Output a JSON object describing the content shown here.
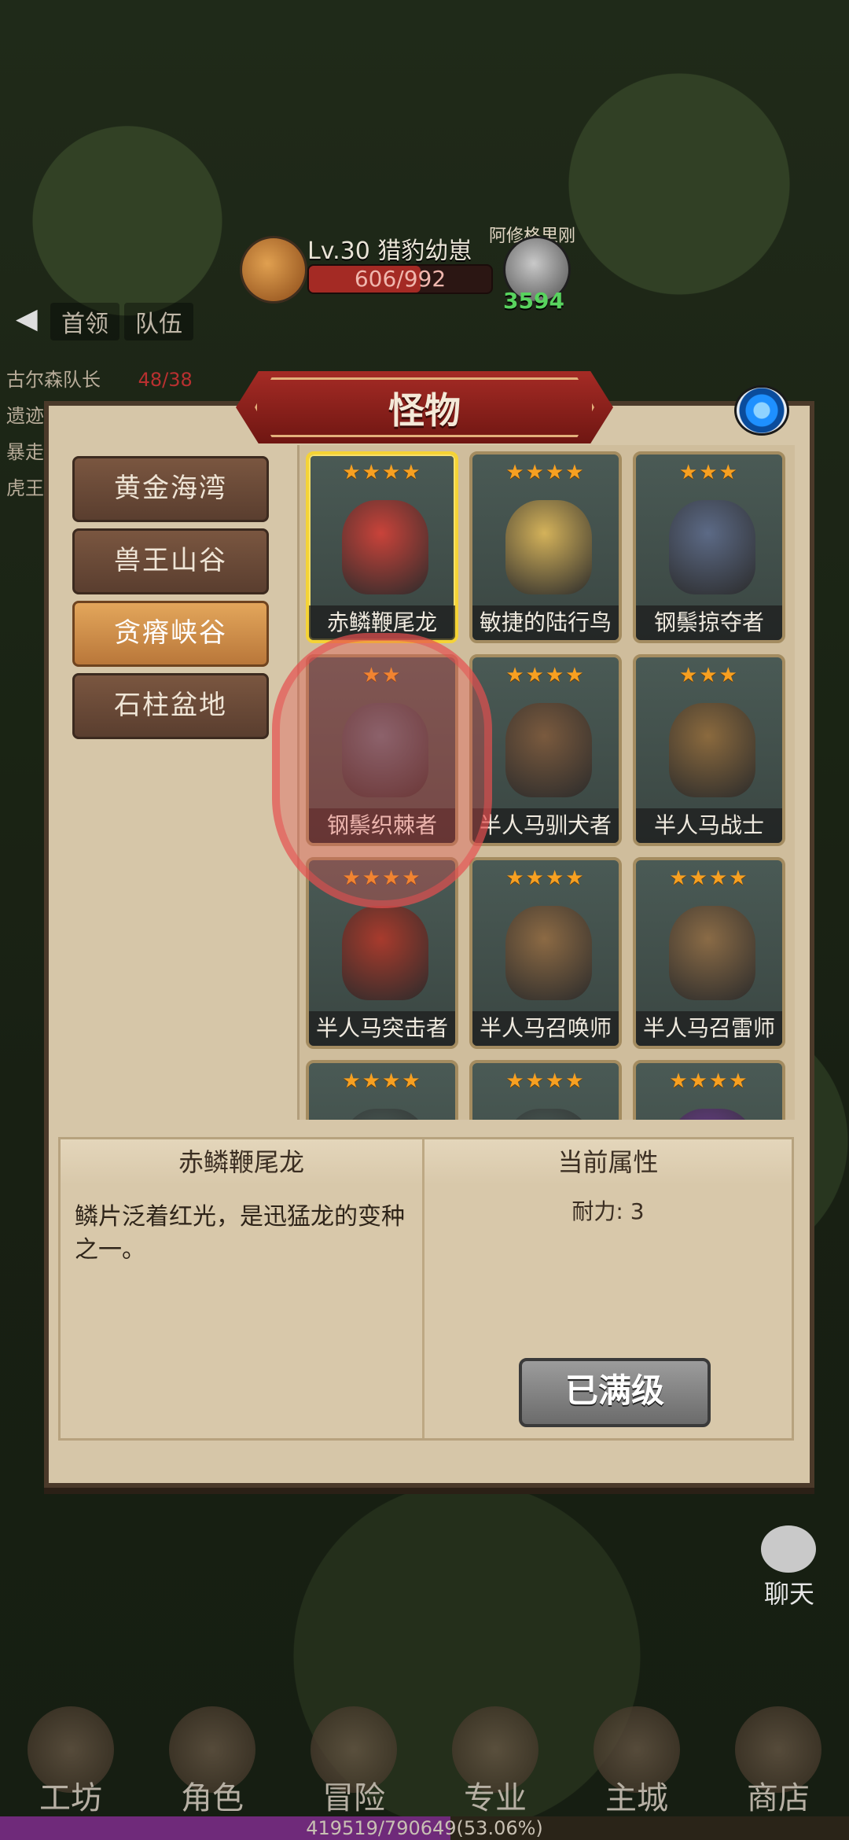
{
  "hud": {
    "boss_name": "Lv.30 猎豹幼崽",
    "boss_hp": "606/992",
    "boss_hp_ratio": 0.61,
    "enemy2_name": "阿修格里刚",
    "enemy2_value": "3594"
  },
  "top_tabs": {
    "back": "◀",
    "leader": "首领",
    "team": "队伍"
  },
  "left_list": [
    "古尔森队长",
    "遗迹",
    "暴走",
    "虎王"
  ],
  "left_list_hp": "48/38",
  "panel": {
    "title": "怪物",
    "regions": [
      {
        "label": "黄金海湾",
        "active": false
      },
      {
        "label": "兽王山谷",
        "active": false
      },
      {
        "label": "贪瘠峡谷",
        "active": true
      },
      {
        "label": "石柱盆地",
        "active": false
      }
    ],
    "monsters": [
      {
        "name": "赤鳞鞭尾龙",
        "stars": "★★★★",
        "selected": true,
        "color": "#c9433a"
      },
      {
        "name": "敏捷的陆行鸟",
        "stars": "★★★★",
        "selected": false,
        "color": "#d4b25a"
      },
      {
        "name": "钢鬃掠夺者",
        "stars": "★★★",
        "selected": false,
        "color": "#5c6a86"
      },
      {
        "name": "钢鬃织棘者",
        "stars": "★★",
        "selected": false,
        "color": "#5d6c7a"
      },
      {
        "name": "半人马驯犬者",
        "stars": "★★★★",
        "selected": false,
        "color": "#7a5a3e"
      },
      {
        "name": "半人马战士",
        "stars": "★★★",
        "selected": false,
        "color": "#8b6a3e"
      },
      {
        "name": "半人马突击者",
        "stars": "★★★★",
        "selected": false,
        "color": "#a83b2d"
      },
      {
        "name": "半人马召唤师",
        "stars": "★★★★",
        "selected": false,
        "color": "#8c6a44"
      },
      {
        "name": "半人马召雷师",
        "stars": "★★★★",
        "selected": false,
        "color": "#8a6b46"
      },
      {
        "name": "",
        "stars": "★★★★",
        "selected": false,
        "color": "#4a5a55"
      },
      {
        "name": "",
        "stars": "★★★★",
        "selected": false,
        "color": "#4a5a55"
      },
      {
        "name": "",
        "stars": "★★★★",
        "selected": false,
        "color": "#6a3f8a"
      }
    ],
    "info": {
      "monster_name": "赤鳞鞭尾龙",
      "description": "鳞片泛着红光，是迅猛龙的变种之一。",
      "attr_title": "当前属性",
      "attr_line": "耐力: 3",
      "max_button": "已满级"
    }
  },
  "chat_label": "聊天",
  "bottom_nav": [
    "工坊",
    "角色",
    "冒险",
    "专业",
    "主城",
    "商店"
  ],
  "xp_text": "419519/790649(53.06%)",
  "xp_ratio": 0.5306
}
